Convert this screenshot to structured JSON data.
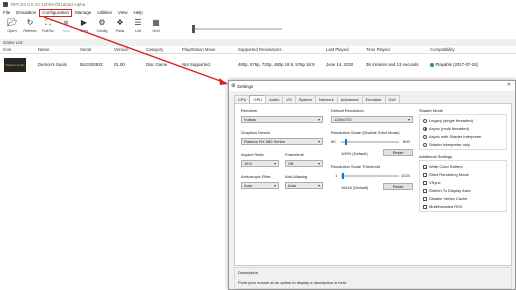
{
  "window": {
    "title": "RPCS3 0.0.10-10009-ff01ab0d Alpha"
  },
  "menu": [
    "File",
    "Emulation",
    "Configuration",
    "Manage",
    "Utilities",
    "View",
    "Help"
  ],
  "toolbar": [
    {
      "label": "Open",
      "icon": "folder-icon"
    },
    {
      "label": "Refresh",
      "icon": "refresh-icon"
    },
    {
      "label": "FullScr",
      "icon": "fullscreen-icon"
    },
    {
      "label": "Stop",
      "icon": "stop-icon"
    },
    {
      "label": "Start",
      "icon": "play-icon"
    },
    {
      "label": "Config",
      "icon": "gear-icon"
    },
    {
      "label": "Pads",
      "icon": "gamepad-icon"
    },
    {
      "label": "List",
      "icon": "list-icon"
    },
    {
      "label": "Grid",
      "icon": "grid-icon"
    }
  ],
  "game_list": {
    "section_label": "Game List",
    "columns": [
      "Icon",
      "Name",
      "Serial",
      "Version",
      "Category",
      "PlayStation Move",
      "Supported Resolutions",
      "Last Played",
      "Time Played",
      "Compatibility"
    ],
    "rows": [
      {
        "icon_text": "Demon's Souls",
        "name": "Demon's Souls",
        "serial": "BLES00932",
        "version": "01.00",
        "category": "Disc Game",
        "move": "Not Supported",
        "resolutions": "480p, 576p, 720p, 480p 16:9, 576p 16:9",
        "last_played": "June 14, 2020",
        "time_played": "36 minutes and 13 seconds",
        "compatibility": "Playable (2017-07-26)"
      }
    ]
  },
  "settings": {
    "title": "Settings",
    "tabs": [
      "CPU",
      "GPU",
      "Audio",
      "I/O",
      "System",
      "Network",
      "Advanced",
      "Emulator",
      "GUI"
    ],
    "renderer": {
      "label": "Renderer",
      "value": "Vulkan"
    },
    "graphics_device": {
      "label": "Graphics Device",
      "value": "Radeon RX 580 Series"
    },
    "aspect_ratio": {
      "label": "Aspect Ratio",
      "value": "16:9"
    },
    "framelimit": {
      "label": "Framelimit",
      "value": "Off"
    },
    "anisotropic": {
      "label": "Anisotropic Filter",
      "value": "Auto"
    },
    "anti_aliasing": {
      "label": "Anti-Aliasing",
      "value": "Auto"
    },
    "default_resolution": {
      "label": "Default Resolution",
      "value": "1280x720"
    },
    "resolution_scale": {
      "label": "Resolution Scale (Disable Strict Mode)",
      "min": "50",
      "max": "800",
      "value_text": "100% (Default)",
      "reset": "Reset",
      "fraction": 0.07
    },
    "scaling_threshold": {
      "label": "Resolution Scale Threshold",
      "min": "1",
      "max": "1024",
      "value_text": "16x16 (Default)",
      "reset": "Reset",
      "fraction": 0.02
    },
    "shader_mode": {
      "label": "Shader Mode",
      "options": [
        {
          "text": "Legacy (single threaded)",
          "selected": false
        },
        {
          "text": "Async (multi threaded)",
          "selected": true
        },
        {
          "text": "Async with Shader Interpreter",
          "selected": false
        },
        {
          "text": "Shader Interpreter only",
          "selected": false
        }
      ]
    },
    "additional": {
      "label": "Additional Settings",
      "options": [
        {
          "text": "Write Color Buffers",
          "checked": true
        },
        {
          "text": "Strict Rendering Mode",
          "checked": false
        },
        {
          "text": "VSync",
          "checked": false
        },
        {
          "text": "Stretch To Display Area",
          "checked": false
        },
        {
          "text": "Disable Vertex Cache",
          "checked": false
        },
        {
          "text": "Multithreaded RSX",
          "checked": false
        }
      ]
    },
    "description": {
      "label": "Description",
      "text": "Point your mouse at an option to display a description in here."
    }
  },
  "colors": {
    "highlight": "#dd2222",
    "playable": "#27a341",
    "accent": "#0078d7"
  }
}
